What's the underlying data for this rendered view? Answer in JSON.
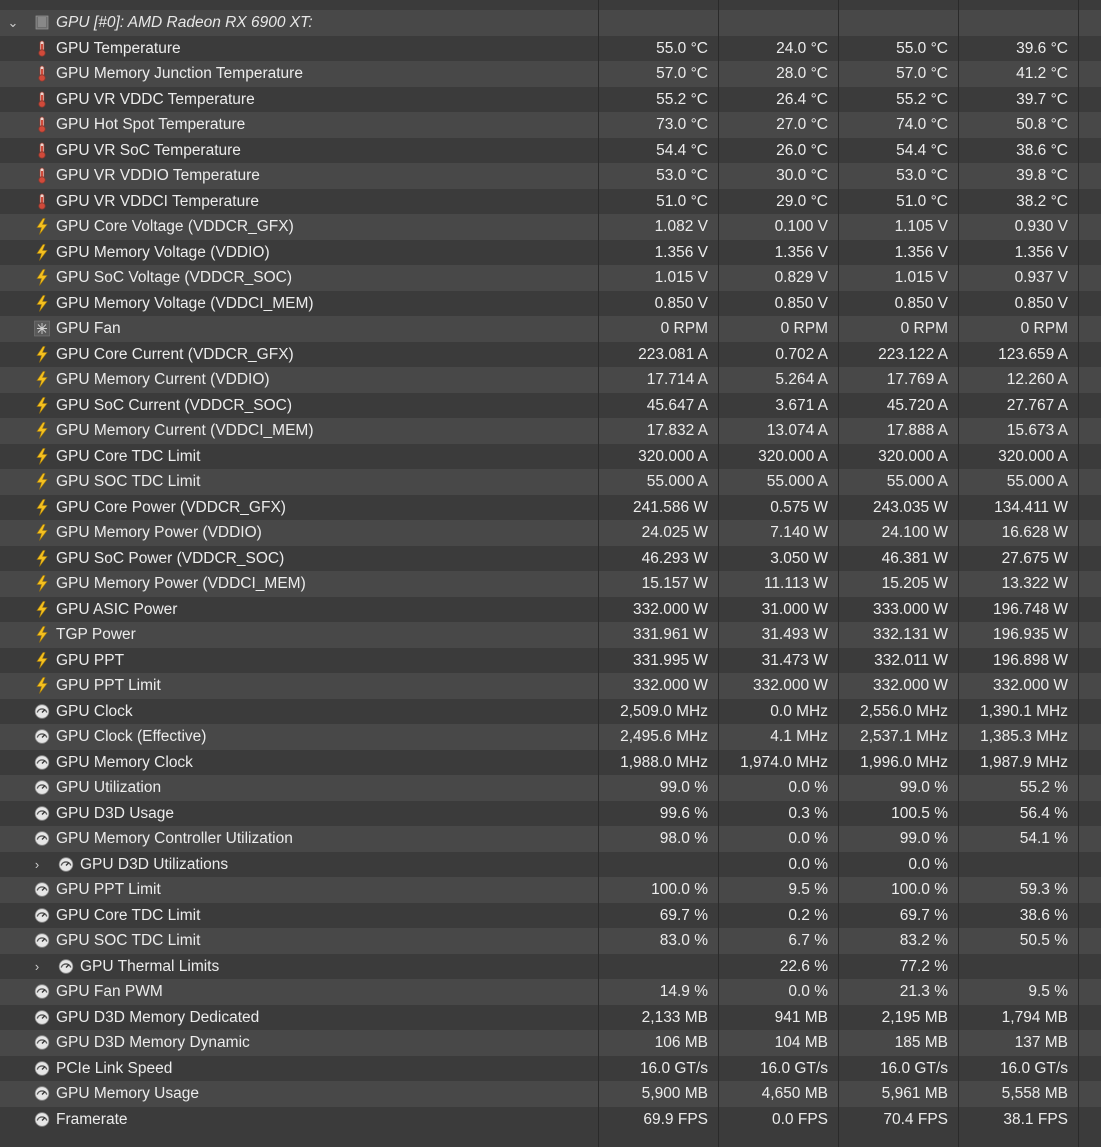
{
  "group": {
    "title": "GPU [#0]: AMD Radeon RX 6900 XT:"
  },
  "rows": [
    {
      "name": "GPU Temperature",
      "icon": "thermometer-icon",
      "cur": "55.0 °C",
      "min": "24.0 °C",
      "max": "55.0 °C",
      "avg": "39.6 °C"
    },
    {
      "name": "GPU Memory Junction Temperature",
      "icon": "thermometer-icon",
      "cur": "57.0 °C",
      "min": "28.0 °C",
      "max": "57.0 °C",
      "avg": "41.2 °C"
    },
    {
      "name": "GPU VR VDDC Temperature",
      "icon": "thermometer-icon",
      "cur": "55.2 °C",
      "min": "26.4 °C",
      "max": "55.2 °C",
      "avg": "39.7 °C"
    },
    {
      "name": "GPU Hot Spot Temperature",
      "icon": "thermometer-icon",
      "cur": "73.0 °C",
      "min": "27.0 °C",
      "max": "74.0 °C",
      "avg": "50.8 °C"
    },
    {
      "name": "GPU VR SoC Temperature",
      "icon": "thermometer-icon",
      "cur": "54.4 °C",
      "min": "26.0 °C",
      "max": "54.4 °C",
      "avg": "38.6 °C"
    },
    {
      "name": "GPU VR VDDIO Temperature",
      "icon": "thermometer-icon",
      "cur": "53.0 °C",
      "min": "30.0 °C",
      "max": "53.0 °C",
      "avg": "39.8 °C"
    },
    {
      "name": "GPU VR VDDCI Temperature",
      "icon": "thermometer-icon",
      "cur": "51.0 °C",
      "min": "29.0 °C",
      "max": "51.0 °C",
      "avg": "38.2 °C"
    },
    {
      "name": "GPU Core Voltage (VDDCR_GFX)",
      "icon": "lightning-icon",
      "cur": "1.082 V",
      "min": "0.100 V",
      "max": "1.105 V",
      "avg": "0.930 V"
    },
    {
      "name": "GPU Memory Voltage (VDDIO)",
      "icon": "lightning-icon",
      "cur": "1.356 V",
      "min": "1.356 V",
      "max": "1.356 V",
      "avg": "1.356 V"
    },
    {
      "name": "GPU SoC Voltage (VDDCR_SOC)",
      "icon": "lightning-icon",
      "cur": "1.015 V",
      "min": "0.829 V",
      "max": "1.015 V",
      "avg": "0.937 V"
    },
    {
      "name": "GPU Memory Voltage (VDDCI_MEM)",
      "icon": "lightning-icon",
      "cur": "0.850 V",
      "min": "0.850 V",
      "max": "0.850 V",
      "avg": "0.850 V"
    },
    {
      "name": "GPU Fan",
      "icon": "fan-icon",
      "cur": "0 RPM",
      "min": "0 RPM",
      "max": "0 RPM",
      "avg": "0 RPM"
    },
    {
      "name": "GPU Core Current (VDDCR_GFX)",
      "icon": "lightning-icon",
      "cur": "223.081 A",
      "min": "0.702 A",
      "max": "223.122 A",
      "avg": "123.659 A"
    },
    {
      "name": "GPU Memory Current (VDDIO)",
      "icon": "lightning-icon",
      "cur": "17.714 A",
      "min": "5.264 A",
      "max": "17.769 A",
      "avg": "12.260 A"
    },
    {
      "name": "GPU SoC Current (VDDCR_SOC)",
      "icon": "lightning-icon",
      "cur": "45.647 A",
      "min": "3.671 A",
      "max": "45.720 A",
      "avg": "27.767 A"
    },
    {
      "name": "GPU Memory Current (VDDCI_MEM)",
      "icon": "lightning-icon",
      "cur": "17.832 A",
      "min": "13.074 A",
      "max": "17.888 A",
      "avg": "15.673 A"
    },
    {
      "name": "GPU Core TDC Limit",
      "icon": "lightning-icon",
      "cur": "320.000 A",
      "min": "320.000 A",
      "max": "320.000 A",
      "avg": "320.000 A"
    },
    {
      "name": "GPU SOC TDC Limit",
      "icon": "lightning-icon",
      "cur": "55.000 A",
      "min": "55.000 A",
      "max": "55.000 A",
      "avg": "55.000 A"
    },
    {
      "name": "GPU Core Power (VDDCR_GFX)",
      "icon": "lightning-icon",
      "cur": "241.586 W",
      "min": "0.575 W",
      "max": "243.035 W",
      "avg": "134.411 W"
    },
    {
      "name": "GPU Memory Power (VDDIO)",
      "icon": "lightning-icon",
      "cur": "24.025 W",
      "min": "7.140 W",
      "max": "24.100 W",
      "avg": "16.628 W"
    },
    {
      "name": "GPU SoC Power (VDDCR_SOC)",
      "icon": "lightning-icon",
      "cur": "46.293 W",
      "min": "3.050 W",
      "max": "46.381 W",
      "avg": "27.675 W"
    },
    {
      "name": "GPU Memory Power (VDDCI_MEM)",
      "icon": "lightning-icon",
      "cur": "15.157 W",
      "min": "11.113 W",
      "max": "15.205 W",
      "avg": "13.322 W"
    },
    {
      "name": "GPU ASIC Power",
      "icon": "lightning-icon",
      "cur": "332.000 W",
      "min": "31.000 W",
      "max": "333.000 W",
      "avg": "196.748 W"
    },
    {
      "name": "TGP Power",
      "icon": "lightning-icon",
      "cur": "331.961 W",
      "min": "31.493 W",
      "max": "332.131 W",
      "avg": "196.935 W"
    },
    {
      "name": "GPU PPT",
      "icon": "lightning-icon",
      "cur": "331.995 W",
      "min": "31.473 W",
      "max": "332.011 W",
      "avg": "196.898 W"
    },
    {
      "name": "GPU PPT Limit",
      "icon": "lightning-icon",
      "cur": "332.000 W",
      "min": "332.000 W",
      "max": "332.000 W",
      "avg": "332.000 W"
    },
    {
      "name": "GPU Clock",
      "icon": "gauge-icon",
      "cur": "2,509.0 MHz",
      "min": "0.0 MHz",
      "max": "2,556.0 MHz",
      "avg": "1,390.1 MHz"
    },
    {
      "name": "GPU Clock (Effective)",
      "icon": "gauge-icon",
      "cur": "2,495.6 MHz",
      "min": "4.1 MHz",
      "max": "2,537.1 MHz",
      "avg": "1,385.3 MHz"
    },
    {
      "name": "GPU Memory Clock",
      "icon": "gauge-icon",
      "cur": "1,988.0 MHz",
      "min": "1,974.0 MHz",
      "max": "1,996.0 MHz",
      "avg": "1,987.9 MHz"
    },
    {
      "name": "GPU Utilization",
      "icon": "gauge-icon",
      "cur": "99.0 %",
      "min": "0.0 %",
      "max": "99.0 %",
      "avg": "55.2 %"
    },
    {
      "name": "GPU D3D Usage",
      "icon": "gauge-icon",
      "cur": "99.6 %",
      "min": "0.3 %",
      "max": "100.5 %",
      "avg": "56.4 %"
    },
    {
      "name": "GPU Memory Controller Utilization",
      "icon": "gauge-icon",
      "cur": "98.0 %",
      "min": "0.0 %",
      "max": "99.0 %",
      "avg": "54.1 %"
    },
    {
      "name": "GPU D3D Utilizations",
      "icon": "gauge-icon",
      "expandable": true,
      "cur": "",
      "min": "0.0 %",
      "max": "0.0 %",
      "avg": ""
    },
    {
      "name": "GPU PPT Limit",
      "icon": "gauge-icon",
      "cur": "100.0 %",
      "min": "9.5 %",
      "max": "100.0 %",
      "avg": "59.3 %"
    },
    {
      "name": "GPU Core TDC Limit",
      "icon": "gauge-icon",
      "cur": "69.7 %",
      "min": "0.2 %",
      "max": "69.7 %",
      "avg": "38.6 %"
    },
    {
      "name": "GPU SOC TDC Limit",
      "icon": "gauge-icon",
      "cur": "83.0 %",
      "min": "6.7 %",
      "max": "83.2 %",
      "avg": "50.5 %"
    },
    {
      "name": "GPU Thermal Limits",
      "icon": "gauge-icon",
      "expandable": true,
      "cur": "",
      "min": "22.6 %",
      "max": "77.2 %",
      "avg": ""
    },
    {
      "name": "GPU Fan PWM",
      "icon": "gauge-icon",
      "cur": "14.9 %",
      "min": "0.0 %",
      "max": "21.3 %",
      "avg": "9.5 %"
    },
    {
      "name": "GPU D3D Memory Dedicated",
      "icon": "gauge-icon",
      "cur": "2,133 MB",
      "min": "941 MB",
      "max": "2,195 MB",
      "avg": "1,794 MB"
    },
    {
      "name": "GPU D3D Memory Dynamic",
      "icon": "gauge-icon",
      "cur": "106 MB",
      "min": "104 MB",
      "max": "185 MB",
      "avg": "137 MB"
    },
    {
      "name": "PCIe Link Speed",
      "icon": "gauge-icon",
      "cur": "16.0 GT/s",
      "min": "16.0 GT/s",
      "max": "16.0 GT/s",
      "avg": "16.0 GT/s"
    },
    {
      "name": "GPU Memory Usage",
      "icon": "gauge-icon",
      "cur": "5,900 MB",
      "min": "4,650 MB",
      "max": "5,961 MB",
      "avg": "5,558 MB"
    },
    {
      "name": "Framerate",
      "icon": "gauge-icon",
      "cur": "69.9 FPS",
      "min": "0.0 FPS",
      "max": "70.4 FPS",
      "avg": "38.1 FPS"
    }
  ],
  "colors": {
    "row_odd": "#484848",
    "row_even": "#3b3b3b",
    "text": "#ececec",
    "thermometer_red": "#d14a3a",
    "lightning_yellow": "#f4c020",
    "gauge_white": "#e6e6e6"
  }
}
